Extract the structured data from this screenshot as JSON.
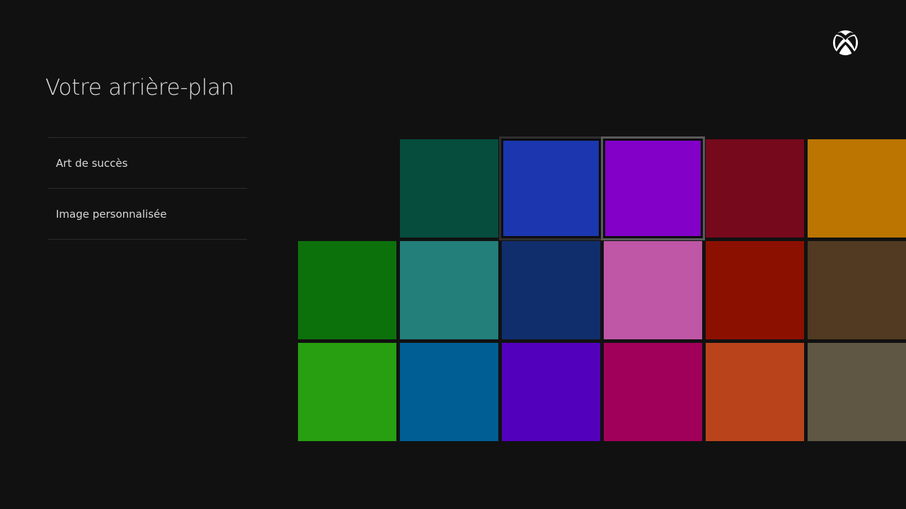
{
  "title": "Votre arrière-plan",
  "menu": [
    {
      "label": "Art de succès"
    },
    {
      "label": "Image personnalisée"
    }
  ],
  "logo_icon": "xbox-logo-icon",
  "colors": [
    [
      null,
      "#064d3e",
      "#1b36ae",
      "#8200c8",
      "#760a1c",
      "#bb7500"
    ],
    [
      "#0d710b",
      "#237f7a",
      "#112e6c",
      "#bf56a6",
      "#8c1000",
      "#513a21"
    ],
    [
      "#279f10",
      "#005e95",
      "#5300bc",
      "#a1005a",
      "#b9441c",
      "#5f5743"
    ]
  ],
  "selected": {
    "row": 0,
    "col": 3
  },
  "hovered": {
    "row": 0,
    "col": 2
  }
}
